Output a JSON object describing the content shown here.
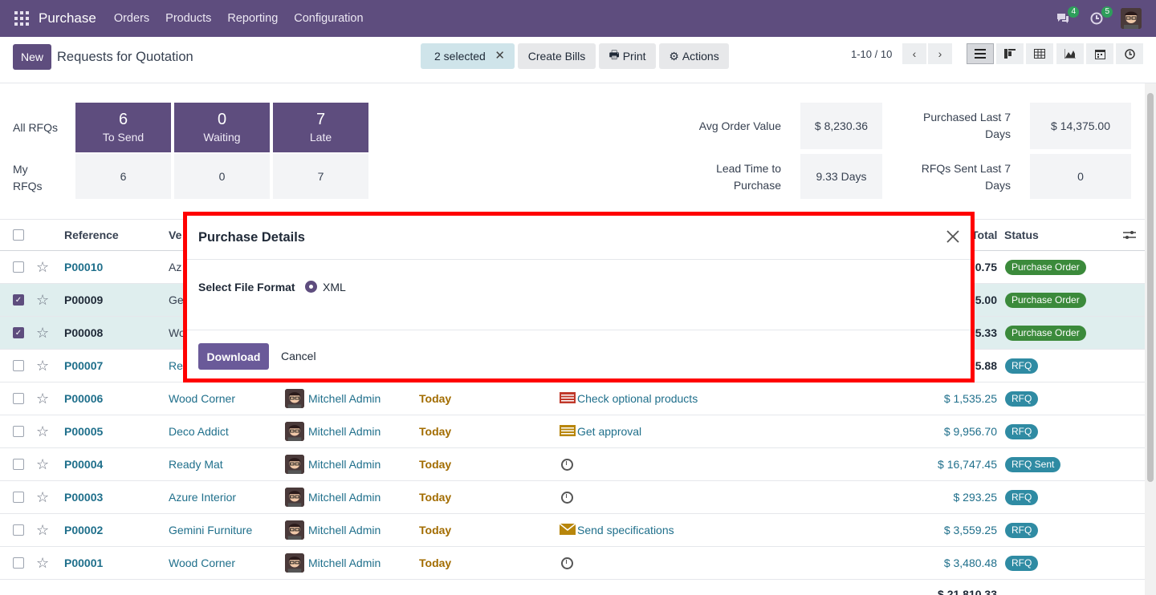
{
  "navbar": {
    "brand": "Purchase",
    "menu": [
      "Orders",
      "Products",
      "Reporting",
      "Configuration"
    ],
    "chat_count": "4",
    "activity_count": "5"
  },
  "control_panel": {
    "new_label": "New",
    "title": "Requests for Quotation",
    "selected_label": "2 selected",
    "create_bills_label": "Create Bills",
    "print_label": "Print",
    "actions_label": "Actions",
    "pager": "1-10 / 10"
  },
  "dashboard": {
    "all_rfqs_label": "All RFQs",
    "my_rfqs_label": "My\nRFQs",
    "tiles": [
      {
        "num": "6",
        "label": "To Send",
        "my": "6"
      },
      {
        "num": "0",
        "label": "Waiting",
        "my": "0"
      },
      {
        "num": "7",
        "label": "Late",
        "my": "7"
      }
    ],
    "stats": {
      "avg_order_label": "Avg Order Value",
      "avg_order_value": "$ 8,230.36",
      "purchased_label": "Purchased Last 7 Days",
      "purchased_value": "$ 14,375.00",
      "lead_time_label": "Lead Time to Purchase",
      "lead_time_value": "9.33 Days",
      "rfqs_sent_label": "RFQs Sent Last 7 Days",
      "rfqs_sent_value": "0"
    }
  },
  "table": {
    "headers": {
      "reference": "Reference",
      "vendor": "Ve",
      "total": "Total",
      "status": "Status"
    },
    "rows": [
      {
        "ref": "P00010",
        "vendor": "Az",
        "buyer": "",
        "deadline": "",
        "activity": "",
        "total": "0.75",
        "status": "Purchase Order",
        "selected": false
      },
      {
        "ref": "P00009",
        "vendor": "Ge",
        "buyer": "",
        "deadline": "",
        "activity": "",
        "total": "5.00",
        "status": "Purchase Order",
        "selected": true
      },
      {
        "ref": "P00008",
        "vendor": "Wo",
        "buyer": "",
        "deadline": "",
        "activity": "",
        "total": "5.33",
        "status": "Purchase Order",
        "selected": true
      },
      {
        "ref": "P00007",
        "vendor": "Re",
        "buyer": "",
        "deadline": "",
        "activity": "",
        "total": "5.88",
        "status": "RFQ",
        "selected": false
      },
      {
        "ref": "P00006",
        "vendor": "Wood Corner",
        "buyer": "Mitchell Admin",
        "deadline": "Today",
        "activity": "Check optional products",
        "total": "$ 1,535.25",
        "status": "RFQ",
        "selected": false
      },
      {
        "ref": "P00005",
        "vendor": "Deco Addict",
        "buyer": "Mitchell Admin",
        "deadline": "Today",
        "activity": "Get approval",
        "total": "$ 9,956.70",
        "status": "RFQ",
        "selected": false
      },
      {
        "ref": "P00004",
        "vendor": "Ready Mat",
        "buyer": "Mitchell Admin",
        "deadline": "Today",
        "activity": "",
        "total": "$ 16,747.45",
        "status": "RFQ Sent",
        "selected": false
      },
      {
        "ref": "P00003",
        "vendor": "Azure Interior",
        "buyer": "Mitchell Admin",
        "deadline": "Today",
        "activity": "",
        "total": "$ 293.25",
        "status": "RFQ",
        "selected": false
      },
      {
        "ref": "P00002",
        "vendor": "Gemini Furniture",
        "buyer": "Mitchell Admin",
        "deadline": "Today",
        "activity": "Send specifications",
        "total": "$ 3,559.25",
        "status": "RFQ",
        "selected": false
      },
      {
        "ref": "P00001",
        "vendor": "Wood Corner",
        "buyer": "Mitchell Admin",
        "deadline": "Today",
        "activity": "",
        "total": "$ 3,480.48",
        "status": "RFQ",
        "selected": false
      }
    ],
    "grand_total": "$ 21,810.33"
  },
  "modal": {
    "title": "Purchase Details",
    "field_label": "Select File Format",
    "option_label": "XML",
    "download_label": "Download",
    "cancel_label": "Cancel"
  },
  "colors": {
    "brand": "#5e4d7e",
    "highlight": "#ff0000",
    "status_po": "#3b8a3b",
    "status_rfq": "#2f8ba3"
  }
}
